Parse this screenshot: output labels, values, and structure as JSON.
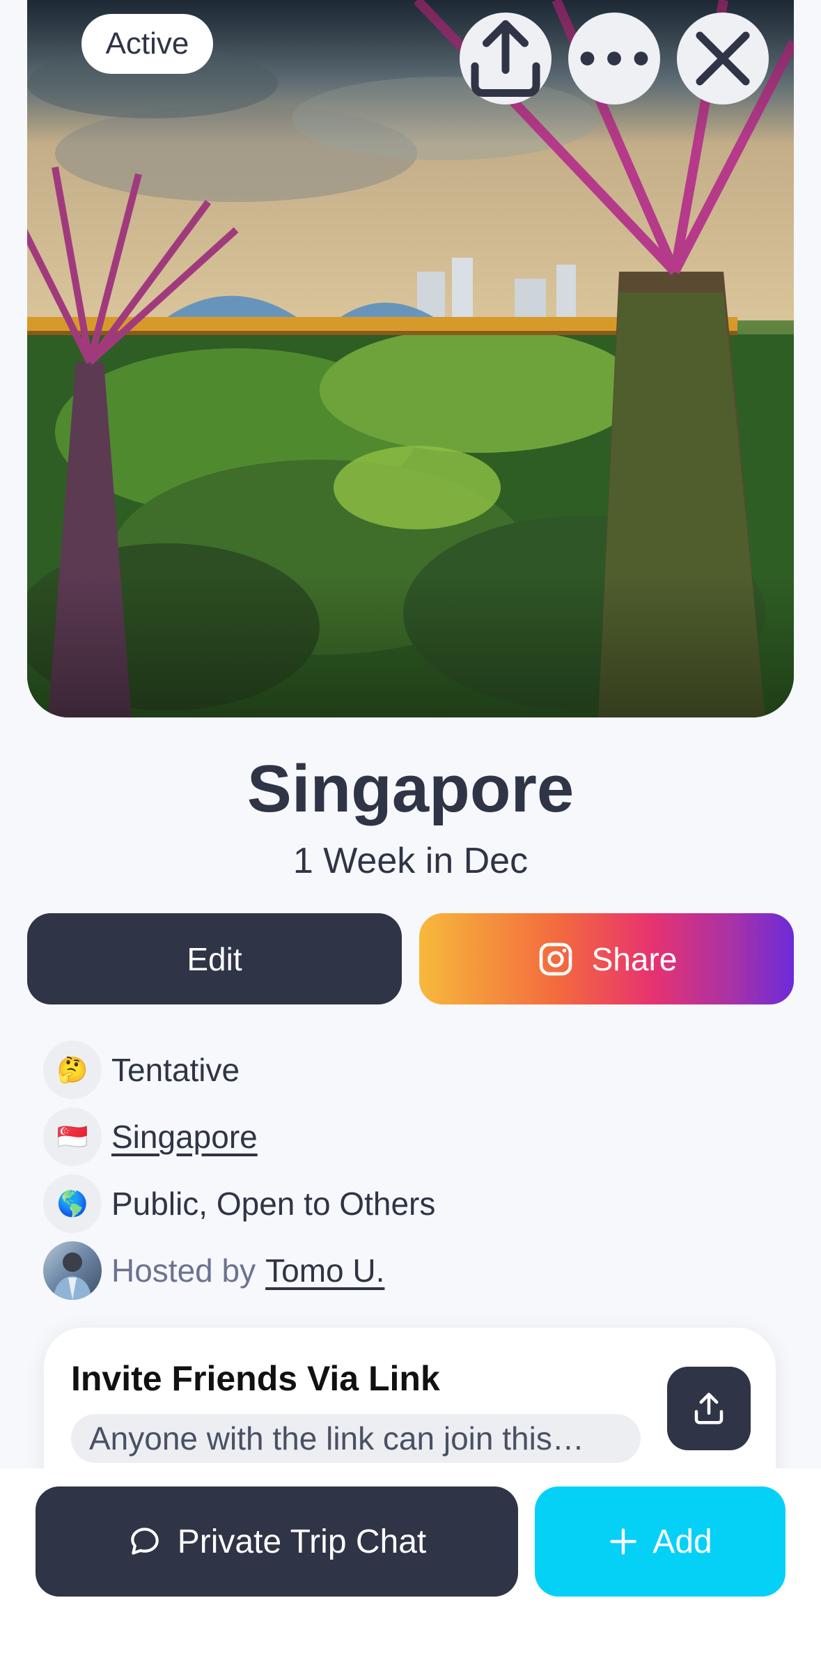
{
  "hero": {
    "status_badge": "Active",
    "actions": {
      "share_icon": "upload-icon",
      "more_icon": "ellipsis-icon",
      "close_icon": "close-icon"
    }
  },
  "trip": {
    "title": "Singapore",
    "subtitle": "1 Week in Dec"
  },
  "buttons": {
    "edit_label": "Edit",
    "share_label": "Share",
    "share_icon": "instagram-icon"
  },
  "details": {
    "status": {
      "emoji": "🤔",
      "text": "Tentative"
    },
    "destination": {
      "emoji": "🇸🇬",
      "text": "Singapore"
    },
    "visibility": {
      "emoji": "🌎",
      "text": "Public, Open to Others"
    },
    "host": {
      "prefix": "Hosted by",
      "name": "Tomo U."
    }
  },
  "invite": {
    "title": "Invite Friends Via Link",
    "subtitle": "Anyone with the link can join this…",
    "icon": "upload-icon"
  },
  "bottom": {
    "chat_label": "Private Trip Chat",
    "chat_icon": "chat-bubble-icon",
    "add_label": "Add",
    "add_icon": "plus-icon"
  },
  "colors": {
    "primary_dark": "#2f3446",
    "accent_cyan": "#05d1f7",
    "background": "#f6f8fb"
  }
}
